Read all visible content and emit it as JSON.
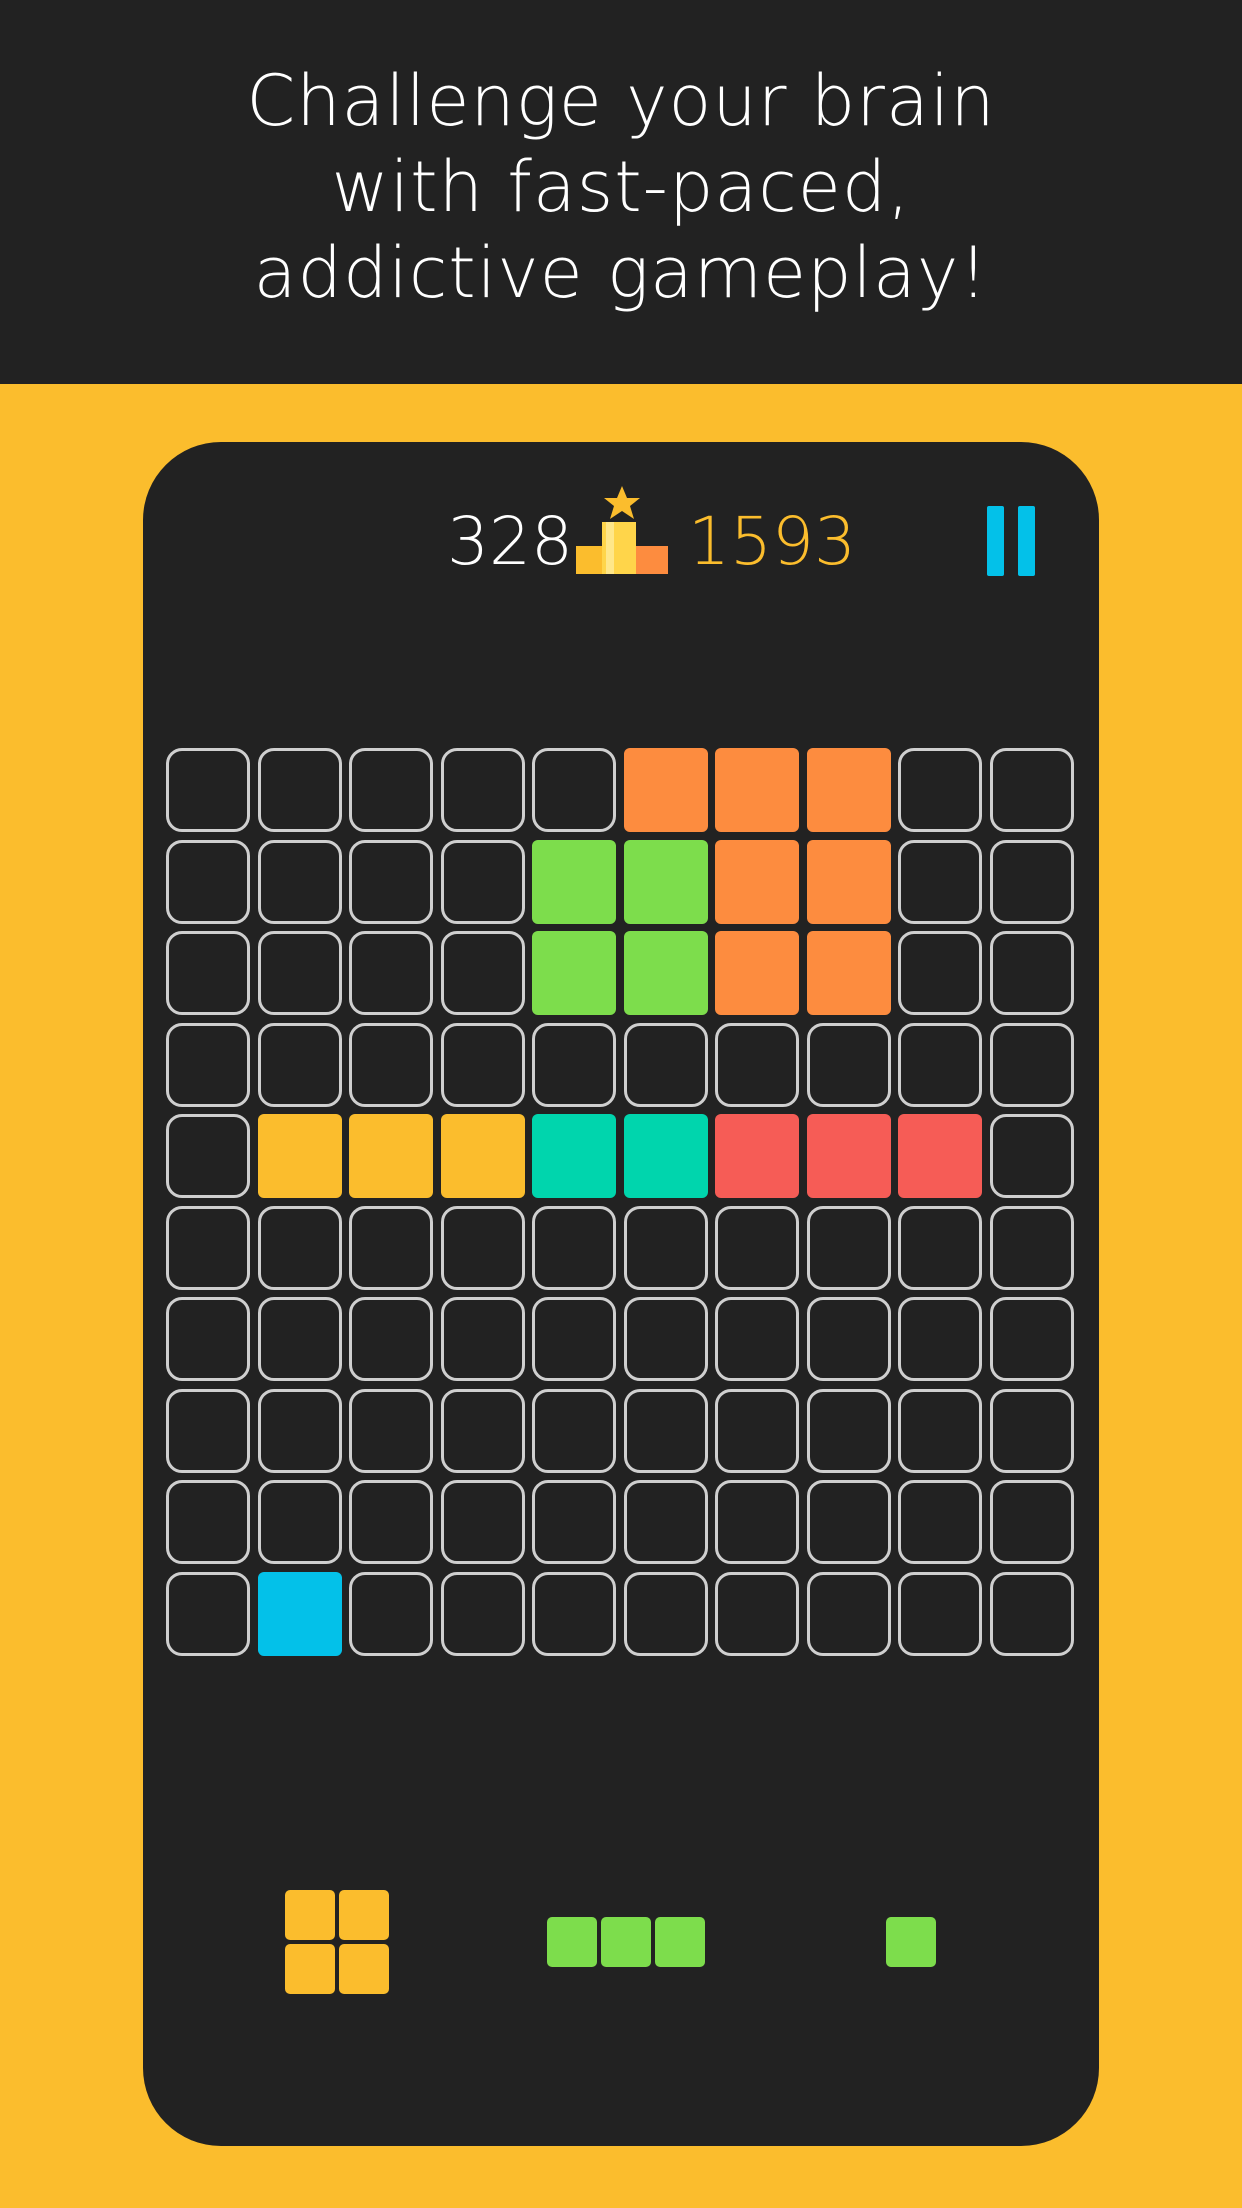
{
  "banner": {
    "line1": "Challenge your brain",
    "line2": "with fast-paced,",
    "line3": "addictive gameplay!"
  },
  "scores": {
    "current": "328",
    "best": "1593"
  },
  "icons": {
    "podium": "podium-star-icon",
    "pause": "pause-icon"
  },
  "colors": {
    "background_yellow": "#fbbd2d",
    "panel_dark": "#222222",
    "cell_outline": "#cfcfcf",
    "orange": "#fd8c3f",
    "green": "#7ddd4c",
    "yellow": "#fbbd2d",
    "teal": "#00d5ad",
    "red": "#f65c56",
    "blue": "#03c1e9"
  },
  "board": {
    "rows": 10,
    "cols": 10,
    "filled": [
      {
        "row": 0,
        "col": 5,
        "color": "orange"
      },
      {
        "row": 0,
        "col": 6,
        "color": "orange"
      },
      {
        "row": 0,
        "col": 7,
        "color": "orange"
      },
      {
        "row": 1,
        "col": 4,
        "color": "green"
      },
      {
        "row": 1,
        "col": 5,
        "color": "green"
      },
      {
        "row": 1,
        "col": 6,
        "color": "orange"
      },
      {
        "row": 1,
        "col": 7,
        "color": "orange"
      },
      {
        "row": 2,
        "col": 4,
        "color": "green"
      },
      {
        "row": 2,
        "col": 5,
        "color": "green"
      },
      {
        "row": 2,
        "col": 6,
        "color": "orange"
      },
      {
        "row": 2,
        "col": 7,
        "color": "orange"
      },
      {
        "row": 4,
        "col": 1,
        "color": "yellow"
      },
      {
        "row": 4,
        "col": 2,
        "color": "yellow"
      },
      {
        "row": 4,
        "col": 3,
        "color": "yellow"
      },
      {
        "row": 4,
        "col": 4,
        "color": "teal"
      },
      {
        "row": 4,
        "col": 5,
        "color": "teal"
      },
      {
        "row": 4,
        "col": 6,
        "color": "red"
      },
      {
        "row": 4,
        "col": 7,
        "color": "red"
      },
      {
        "row": 4,
        "col": 8,
        "color": "red"
      },
      {
        "row": 9,
        "col": 1,
        "color": "blue"
      }
    ]
  },
  "tray": {
    "pieces": [
      {
        "name": "square-2x2",
        "color": "yellow",
        "cells": [
          [
            0,
            0
          ],
          [
            0,
            1
          ],
          [
            1,
            0
          ],
          [
            1,
            1
          ]
        ]
      },
      {
        "name": "line-1x3",
        "color": "green",
        "cells": [
          [
            0,
            0
          ],
          [
            0,
            1
          ],
          [
            0,
            2
          ]
        ]
      },
      {
        "name": "single-1x1",
        "color": "green",
        "cells": [
          [
            0,
            0
          ]
        ]
      }
    ]
  }
}
